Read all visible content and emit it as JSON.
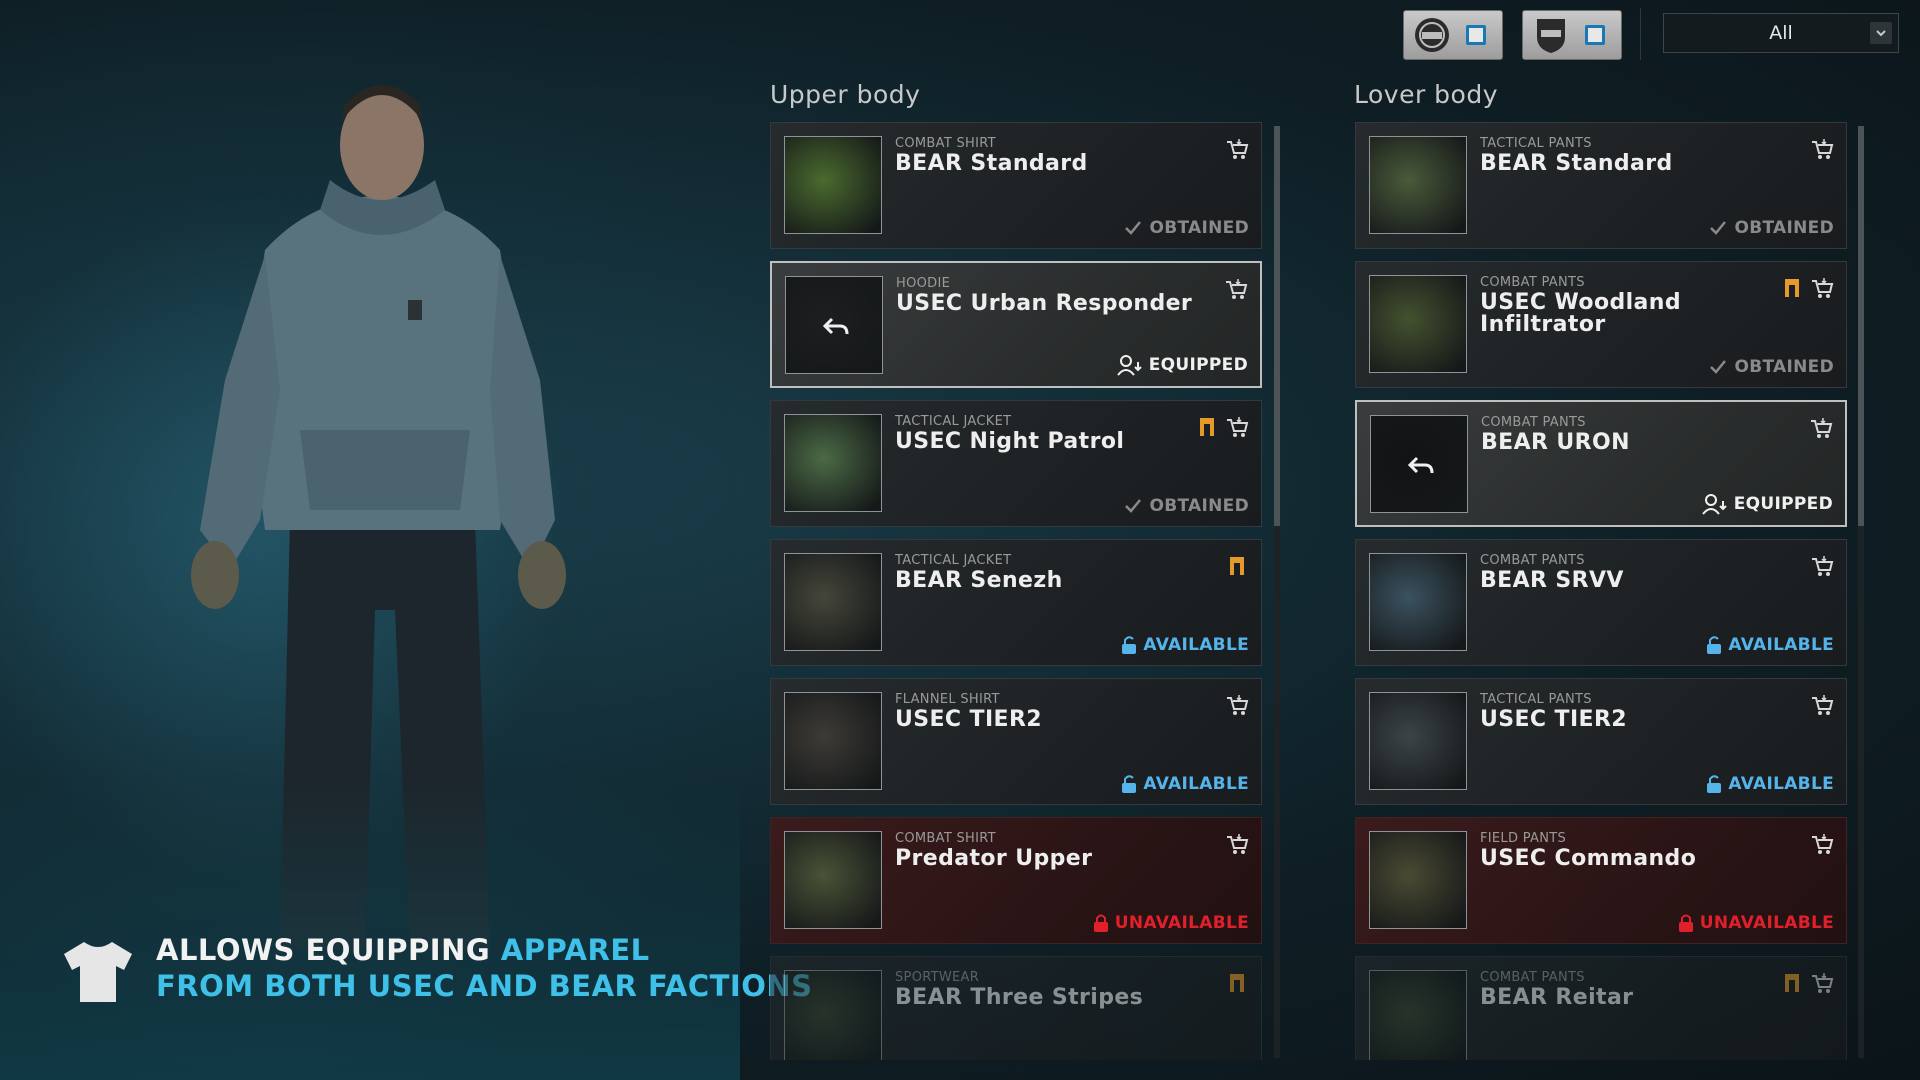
{
  "header": {
    "factions": [
      {
        "name": "BEAR"
      },
      {
        "name": "USEC"
      }
    ],
    "filter_value": "All"
  },
  "perk": {
    "line1_white": "ALLOWS EQUIPPING ",
    "line1_cyan": "APPAREL",
    "line2_cyan": "FROM BOTH USEC AND BEAR FACTIONS"
  },
  "upper": {
    "title": "Upper body",
    "items": [
      {
        "kind": "COMBAT SHIRT",
        "name": "BEAR Standard",
        "status": "OBTAINED",
        "state": "obtained",
        "icons": [
          "cart"
        ],
        "thumb_color": "#4a6b2e"
      },
      {
        "kind": "HOODIE",
        "name": "USEC Urban Responder",
        "status": "EQUIPPED",
        "state": "equipped",
        "icons": [
          "cart"
        ],
        "thumb_color": "#1c1e20"
      },
      {
        "kind": "TACTICAL JACKET",
        "name": "USEC Night Patrol",
        "status": "OBTAINED",
        "state": "obtained",
        "icons": [
          "prestige",
          "cart"
        ],
        "thumb_color": "#4b6a45"
      },
      {
        "kind": "TACTICAL JACKET",
        "name": "BEAR Senezh",
        "status": "AVAILABLE",
        "state": "available",
        "icons": [
          "prestige"
        ],
        "thumb_color": "#45463a"
      },
      {
        "kind": "FLANNEL SHIRT",
        "name": "USEC TIER2",
        "status": "AVAILABLE",
        "state": "available",
        "icons": [
          "cart"
        ],
        "thumb_color": "#3e3b36"
      },
      {
        "kind": "COMBAT SHIRT",
        "name": "Predator Upper",
        "status": "UNAVAILABLE",
        "state": "unavailable",
        "icons": [
          "cart"
        ],
        "thumb_color": "#4a5237"
      },
      {
        "kind": "SPORTWEAR",
        "name": "BEAR Three Stripes",
        "status": "",
        "state": "dim",
        "icons": [
          "prestige"
        ],
        "thumb_color": "#3c4530"
      }
    ]
  },
  "lower": {
    "title": "Lover body",
    "items": [
      {
        "kind": "TACTICAL PANTS",
        "name": "BEAR Standard",
        "status": "OBTAINED",
        "state": "obtained",
        "icons": [
          "cart"
        ],
        "thumb_color": "#4a5a3a"
      },
      {
        "kind": "COMBAT PANTS",
        "name": "USEC Woodland Infiltrator",
        "status": "OBTAINED",
        "state": "obtained",
        "icons": [
          "prestige",
          "cart"
        ],
        "thumb_color": "#44512f"
      },
      {
        "kind": "COMBAT PANTS",
        "name": "BEAR URON",
        "status": "EQUIPPED",
        "state": "equipped",
        "icons": [
          "cart"
        ],
        "thumb_color": "#121314"
      },
      {
        "kind": "COMBAT PANTS",
        "name": "BEAR SRVV",
        "status": "AVAILABLE",
        "state": "available",
        "icons": [
          "cart"
        ],
        "thumb_color": "#3b5260"
      },
      {
        "kind": "TACTICAL PANTS",
        "name": "USEC TIER2",
        "status": "AVAILABLE",
        "state": "available",
        "icons": [
          "cart"
        ],
        "thumb_color": "#3c4448"
      },
      {
        "kind": "FIELD PANTS",
        "name": "USEC Commando",
        "status": "UNAVAILABLE",
        "state": "unavailable",
        "icons": [
          "cart"
        ],
        "thumb_color": "#4a4a33"
      },
      {
        "kind": "COMBAT PANTS",
        "name": "BEAR Reitar",
        "status": "",
        "state": "dim",
        "icons": [
          "prestige",
          "cart"
        ],
        "thumb_color": "#3d4a33"
      }
    ]
  },
  "colors": {
    "available": "#55b4ea",
    "unavailable": "#e0202b",
    "prestige": "#e39a2a",
    "perk_cyan": "#3fc0e8"
  }
}
